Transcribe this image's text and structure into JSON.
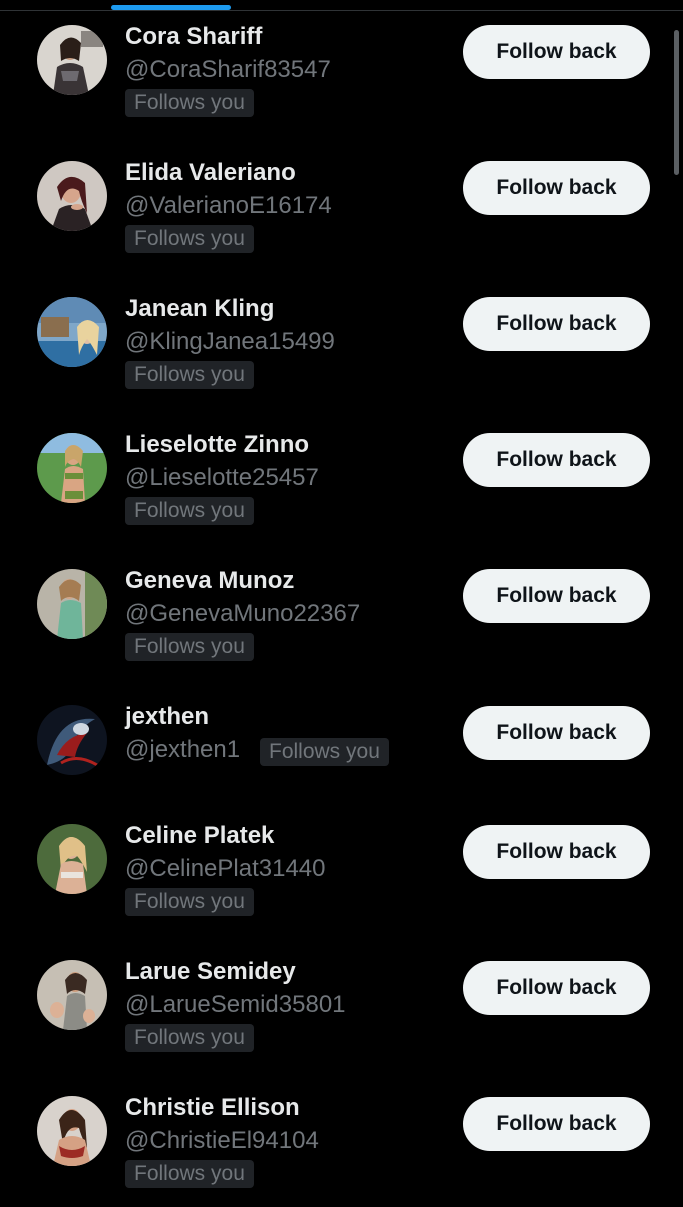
{
  "colors": {
    "background": "#000000",
    "accent": "#1d9bf0",
    "name_text": "#e7e9ea",
    "secondary_text": "#71767b",
    "badge_bg": "#202327",
    "button_bg": "#eff3f4",
    "button_text": "#0f1419"
  },
  "followers": [
    {
      "name": "Cora Shariff",
      "handle": "@CoraSharif83547",
      "follows_you": "Follows you",
      "button": "Follow back"
    },
    {
      "name": "Elida Valeriano",
      "handle": "@ValerianoE16174",
      "follows_you": "Follows you",
      "button": "Follow back"
    },
    {
      "name": "Janean Kling",
      "handle": "@KlingJanea15499",
      "follows_you": "Follows you",
      "button": "Follow back"
    },
    {
      "name": "Lieselotte Zinno",
      "handle": "@Lieselotte25457",
      "follows_you": "Follows you",
      "button": "Follow back"
    },
    {
      "name": "Geneva Munoz",
      "handle": "@GenevaMuno22367",
      "follows_you": "Follows you",
      "button": "Follow back"
    },
    {
      "name": "jexthen",
      "handle": "@jexthen1",
      "follows_you": "Follows you",
      "button": "Follow back"
    },
    {
      "name": "Celine Platek",
      "handle": "@CelinePlat31440",
      "follows_you": "Follows you",
      "button": "Follow back"
    },
    {
      "name": "Larue Semidey",
      "handle": "@LarueSemid35801",
      "follows_you": "Follows you",
      "button": "Follow back"
    },
    {
      "name": "Christie Ellison",
      "handle": "@ChristieEl94104",
      "follows_you": "Follows you",
      "button": "Follow back"
    }
  ]
}
